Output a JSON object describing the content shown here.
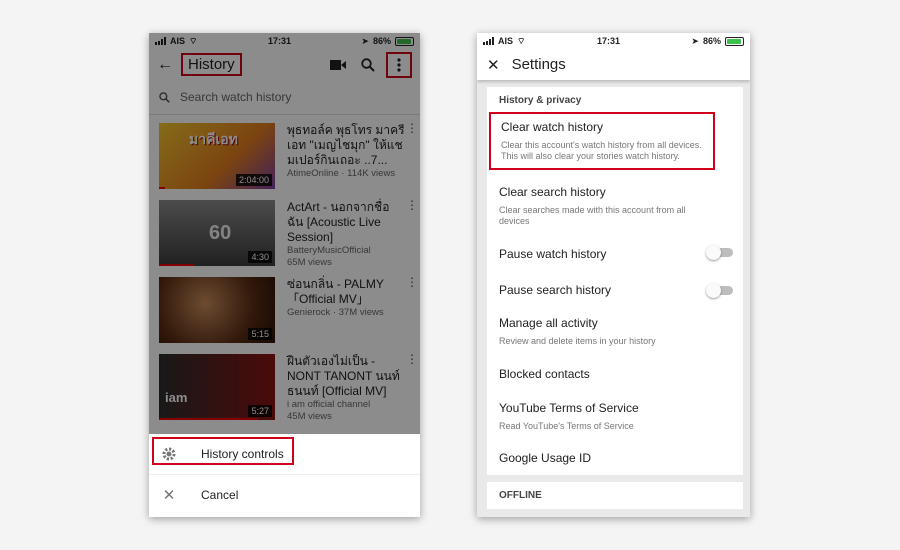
{
  "status_left": {
    "carrier": "AIS",
    "time": "17:31",
    "battery": "86%"
  },
  "status_right": {
    "carrier": "AIS",
    "time": "17:31",
    "battery": "86%"
  },
  "history_screen": {
    "title": "History",
    "search_placeholder": "Search watch history",
    "videos": [
      {
        "title": "พุธทอล์ค พุธโทร มาครีเอท \"เมญไชมุก\" ให้แชมเปอร์กินเถอะ ..7...",
        "channel_views": "AtimeOnline · 114K views",
        "duration": "2:04:00",
        "progress": 0.05,
        "thumb_text": "มาคีเอท"
      },
      {
        "title": "ActArt - นอกจากชื่อ ฉัน [Acoustic Live Session]",
        "channel": "BatteryMusicOfficial",
        "views": "65M views",
        "duration": "4:30",
        "progress": 0.3,
        "thumb_text": "60"
      },
      {
        "title": "ซ่อนกลิ่น - PALMY 「Official MV」",
        "channel_views": "Genierock · 37M views",
        "duration": "5:15",
        "progress": 0.0
      },
      {
        "title": "ฝืนตัวเองไม่เป็น - NONT TANONT นนท์ ธนนท์ [Official MV]",
        "channel": "i am official channel",
        "views": "45M views",
        "duration": "5:27",
        "progress": 0.85,
        "thumb_text": "iam"
      }
    ],
    "sheet": {
      "history_controls": "History controls",
      "cancel": "Cancel"
    }
  },
  "settings_screen": {
    "title": "Settings",
    "section": "History & privacy",
    "items": [
      {
        "title": "Clear watch history",
        "subtitle": "Clear this account's watch history from all devices. This will also clear your stories watch history."
      },
      {
        "title": "Clear search history",
        "subtitle": "Clear searches made with this account from all devices"
      },
      {
        "title": "Pause watch history",
        "toggle": false
      },
      {
        "title": "Pause search history",
        "toggle": false
      },
      {
        "title": "Manage all activity",
        "subtitle": "Review and delete items in your history"
      },
      {
        "title": "Blocked contacts"
      },
      {
        "title": "YouTube Terms of Service",
        "subtitle": "Read YouTube's Terms of Service"
      },
      {
        "title": "Google Usage ID"
      }
    ],
    "offline": "OFFLINE"
  },
  "colors": {
    "highlight": "#d0021b",
    "progress": "#e00000",
    "battery": "#3cc24c"
  }
}
